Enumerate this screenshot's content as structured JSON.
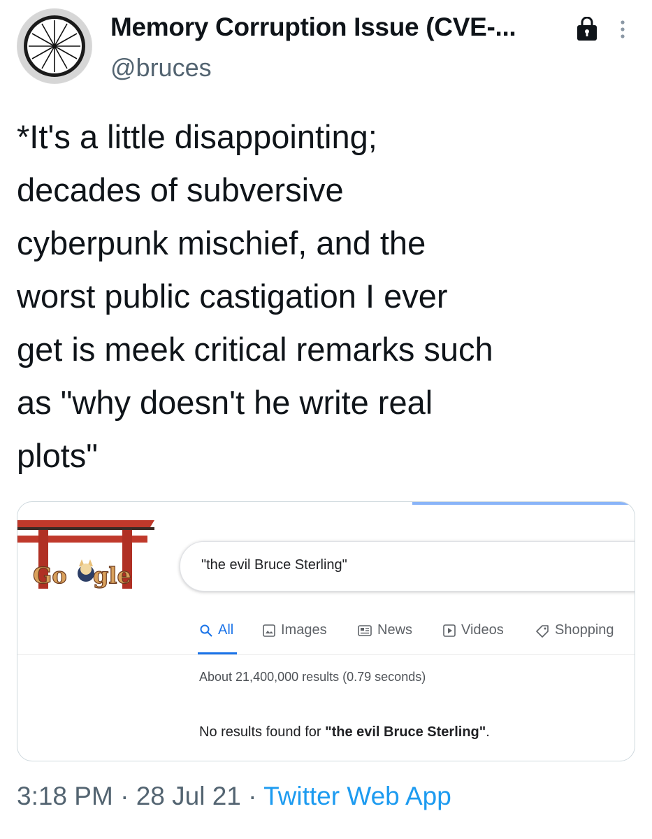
{
  "tweet": {
    "display_name": "Memory Corruption Issue (CVE-...",
    "handle": "@bruces",
    "text_lines": [
      "*It's a little disappointing;",
      "decades of subversive",
      "cyberpunk mischief, and the",
      "worst public castigation I ever",
      "get is meek critical remarks such",
      "as \"why doesn't he write real",
      "plots\""
    ],
    "time": "3:18 PM",
    "separator": " · ",
    "date": "28 Jul 21",
    "source": "Twitter Web App",
    "icons": {
      "lock": "lock-icon",
      "more": "more-vertical-icon",
      "avatar": "clock-avatar"
    },
    "colors": {
      "link": "#1d9bf0",
      "secondary": "#536471"
    }
  },
  "screenshot": {
    "doodle_alt": "Google",
    "search_query": "\"the evil Bruce Sterling\"",
    "tabs": [
      {
        "label": "All",
        "icon": "search-icon",
        "active": true
      },
      {
        "label": "Images",
        "icon": "image-icon",
        "active": false
      },
      {
        "label": "News",
        "icon": "news-icon",
        "active": false
      },
      {
        "label": "Videos",
        "icon": "video-icon",
        "active": false
      },
      {
        "label": "Shopping",
        "icon": "tag-icon",
        "active": false
      }
    ],
    "result_stats": "About 21,400,000 results (0.79 seconds)",
    "no_results_prefix": "No results found for ",
    "no_results_query": "\"the evil Bruce Sterling\"",
    "no_results_suffix": ".",
    "colors": {
      "active_tab": "#1a73e8"
    }
  }
}
